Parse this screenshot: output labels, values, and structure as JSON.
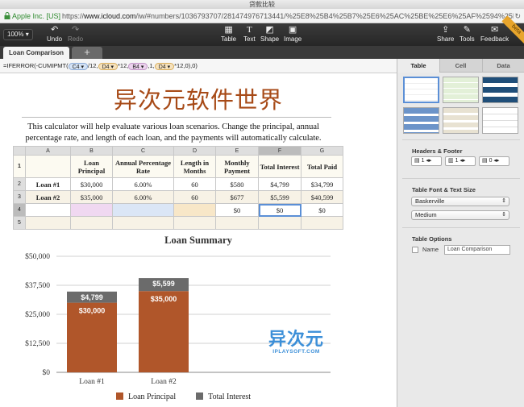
{
  "window": {
    "title": "贷款比较"
  },
  "address": {
    "site_identity": "Apple Inc. [US]",
    "url_prefix": "https://",
    "url_host": "www.icloud.com",
    "url_rest": "/iw/#numbers/1036793707/281474976713441/%25E8%25B4%25B7%25E6%25AC%25BE%25E6%25AF%2594%25E8%2..."
  },
  "toolbar": {
    "zoom": "100%",
    "undo": "Undo",
    "redo": "Redo",
    "table": "Table",
    "text": "Text",
    "shape": "Shape",
    "image": "Image",
    "share": "Share",
    "tools": "Tools",
    "feedback": "Feedback",
    "beta": "beta"
  },
  "sheet_tabs": {
    "active": "Loan Comparison",
    "add": "+"
  },
  "formula": {
    "prefix": "=IFERROR(-CUMIPMT(",
    "t1": "C4 ▾",
    "s1": "/12,",
    "t2": "D4 ▾",
    "s2": "*12,",
    "t3": "B4 ▾",
    "s3": ",1,",
    "t4": "D4 ▾",
    "s4": "*12,0),0)"
  },
  "document": {
    "title": "异次元软件世界",
    "description": "This calculator will help evaluate various loan scenarios. Change the principal, annual percentage rate, and length of each loan, and the payments will automatically calculate."
  },
  "table": {
    "col_headers": [
      "A",
      "B",
      "C",
      "D",
      "E",
      "F",
      "G"
    ],
    "row_headers": [
      "1",
      "2",
      "3",
      "4",
      "5"
    ],
    "headers": [
      "",
      "Loan Principal",
      "Annual Percentage Rate",
      "Length in Months",
      "Monthly Payment",
      "Total Interest",
      "Total Paid"
    ],
    "rows": [
      [
        "Loan #1",
        "$30,000",
        "6.00%",
        "60",
        "$580",
        "$4,799",
        "$34,799"
      ],
      [
        "Loan #2",
        "$35,000",
        "6.00%",
        "60",
        "$677",
        "$5,599",
        "$40,599"
      ],
      [
        "",
        "",
        "",
        "",
        "$0",
        "$0",
        "$0"
      ],
      [
        "",
        "",
        "",
        "",
        "",
        "",
        ""
      ]
    ]
  },
  "chart_data": {
    "type": "bar",
    "stacked": true,
    "title": "Loan Summary",
    "categories": [
      "Loan #1",
      "Loan #2"
    ],
    "series": [
      {
        "name": "Loan Principal",
        "values": [
          30000,
          35000
        ],
        "labels": [
          "$30,000",
          "$35,000"
        ],
        "color": "#b0562a"
      },
      {
        "name": "Total Interest",
        "values": [
          4799,
          5599
        ],
        "labels": [
          "$4,799",
          "$5,599"
        ],
        "color": "#6b6b6b"
      }
    ],
    "ylim": [
      0,
      50000
    ],
    "yticks": [
      0,
      12500,
      25000,
      37500,
      50000
    ],
    "ytick_labels": [
      "$0",
      "$12,500",
      "$25,000",
      "$37,500",
      "$50,000"
    ],
    "grid": true,
    "legend": "bottom"
  },
  "watermark": {
    "text": "异次元",
    "sub": "IPLAYSOFT.COM"
  },
  "inspector": {
    "tabs": [
      "Table",
      "Cell",
      "Data"
    ],
    "headers_footer_label": "Headers & Footer",
    "header_rows": "1",
    "header_cols": "1",
    "footer_rows": "0",
    "font_section_label": "Table Font & Text Size",
    "font": "Baskerville",
    "size": "Medium",
    "options_label": "Table Options",
    "name_label": "Name",
    "name_value": "Loan Comparison"
  },
  "colors": {
    "title": "#a74a17",
    "accent": "#b0562a",
    "interest": "#6b6b6b"
  }
}
